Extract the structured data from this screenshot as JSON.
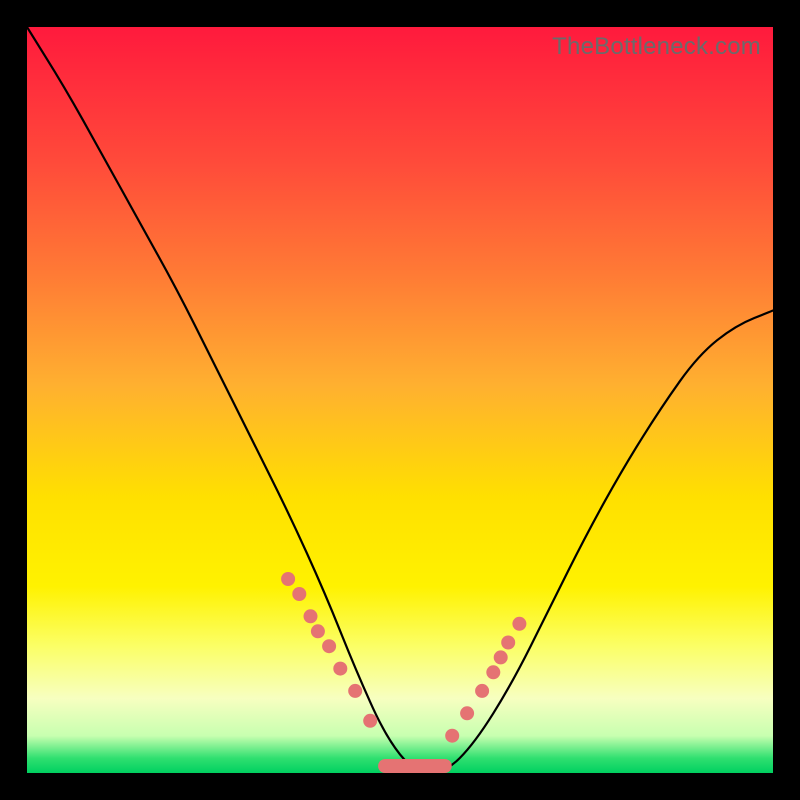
{
  "watermark": "TheBottleneck.com",
  "colors": {
    "frame": "#000000",
    "curve": "#000000",
    "markers": "#e57373",
    "gradient_top": "#ff1a3d",
    "gradient_bottom": "#00d060"
  },
  "chart_data": {
    "type": "line",
    "title": "",
    "xlabel": "",
    "ylabel": "",
    "xlim": [
      0,
      100
    ],
    "ylim": [
      0,
      100
    ],
    "grid": false,
    "annotations": [
      "TheBottleneck.com"
    ],
    "series": [
      {
        "name": "bottleneck-curve",
        "x": [
          0,
          5,
          10,
          15,
          20,
          25,
          30,
          35,
          40,
          44,
          48,
          52,
          56,
          60,
          65,
          70,
          75,
          80,
          85,
          90,
          95,
          100
        ],
        "y": [
          100,
          92,
          83,
          74,
          65,
          55,
          45,
          35,
          24,
          14,
          5,
          0,
          0,
          4,
          12,
          22,
          32,
          41,
          49,
          56,
          60,
          62
        ]
      }
    ],
    "markers": {
      "name": "highlighted-points",
      "x": [
        35,
        36.5,
        38,
        39,
        40.5,
        42,
        44,
        46,
        57,
        59,
        61,
        62.5,
        63.5,
        64.5,
        66
      ],
      "y": [
        26,
        24,
        21,
        19,
        17,
        14,
        11,
        7,
        5,
        8,
        11,
        13.5,
        15.5,
        17.5,
        20
      ]
    },
    "flat_region": {
      "x_start": 48,
      "x_end": 56,
      "y": 0
    }
  }
}
